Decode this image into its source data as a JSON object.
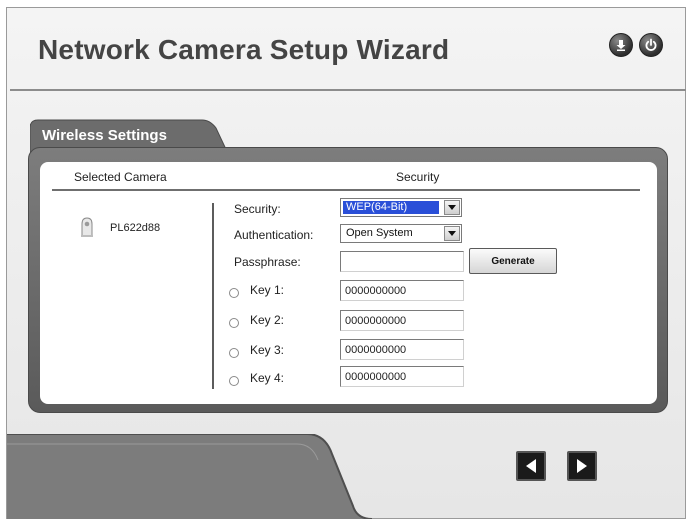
{
  "header": {
    "title": "Network Camera Setup Wizard",
    "download_icon": "download-icon",
    "power_icon": "power-icon"
  },
  "panel": {
    "tab_label": "Wireless Settings",
    "col_selected_camera": "Selected Camera",
    "col_security": "Security"
  },
  "camera": {
    "icon": "camera-icon",
    "name": "PL622d88"
  },
  "form": {
    "security_label": "Security:",
    "security_value": "WEP(64-Bit)",
    "authentication_label": "Authentication:",
    "authentication_value": "Open System",
    "passphrase_label": "Passphrase:",
    "passphrase_value": "",
    "generate_label": "Generate",
    "keys": [
      {
        "label": "Key 1:",
        "value": "0000000000"
      },
      {
        "label": "Key 2:",
        "value": "0000000000"
      },
      {
        "label": "Key 3:",
        "value": "0000000000"
      },
      {
        "label": "Key 4:",
        "value": "0000000000"
      }
    ]
  },
  "nav": {
    "back_icon": "back-arrow-icon",
    "next_icon": "next-arrow-icon"
  },
  "colors": {
    "selection_blue": "#2a4fd8",
    "panel_gray": "#6b6b6b",
    "title_gray": "#444444"
  }
}
